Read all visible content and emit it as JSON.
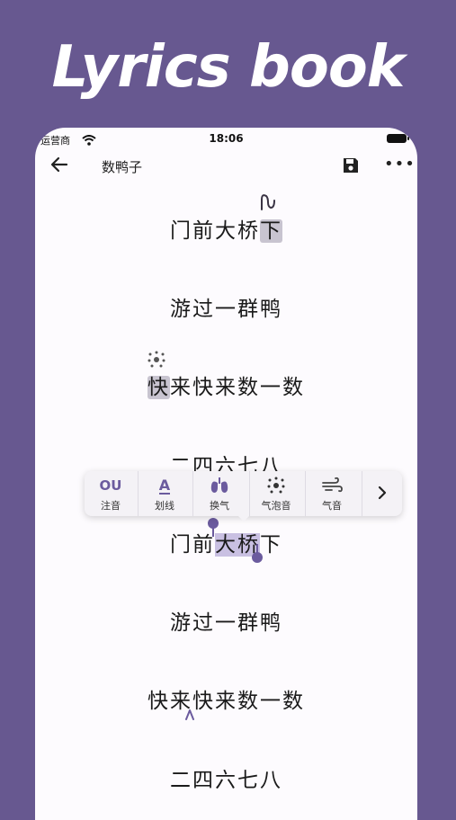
{
  "headline": "Lyrics book",
  "status": {
    "carrier": "运营商",
    "time": "18:06"
  },
  "appbar": {
    "title": "数鸭子"
  },
  "lyrics": [
    {
      "pre": "门前大桥",
      "mark": "下",
      "post": ""
    },
    {
      "text": "游过一群鸭"
    },
    {
      "pre": "",
      "mark": "快",
      "post": "来快来数一数"
    },
    {
      "text": "二四六七八"
    },
    {
      "pre": "门前",
      "sel": "大桥",
      "post": "下"
    },
    {
      "text": "游过一群鸭"
    },
    {
      "text": "快来快来数一数"
    },
    {
      "text": "二四六七八"
    }
  ],
  "toolbar": {
    "items": [
      {
        "icon": "ou-phonetic-icon",
        "icon_text": "OU",
        "label": "注音"
      },
      {
        "icon": "underline-a-icon",
        "icon_text": "A",
        "label": "划线"
      },
      {
        "icon": "lungs-icon",
        "label": "换气"
      },
      {
        "icon": "bubble-dots-icon",
        "label": "气泡音"
      },
      {
        "icon": "wind-icon",
        "label": "气音"
      }
    ]
  },
  "colors": {
    "background": "#675890",
    "accent": "#6b5b9e"
  }
}
